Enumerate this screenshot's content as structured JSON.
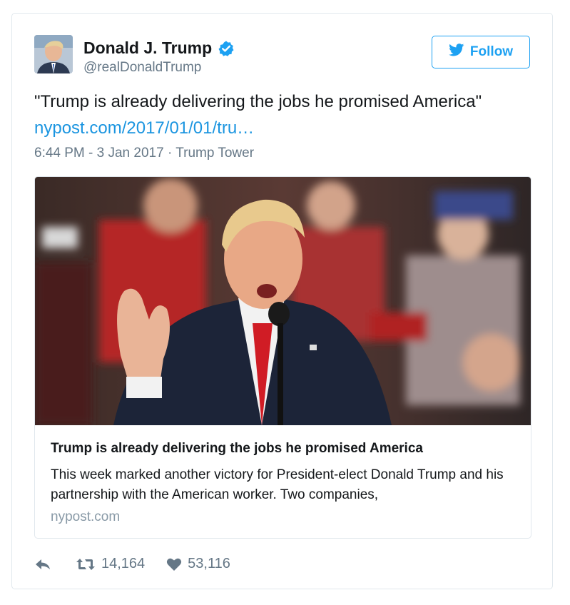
{
  "user": {
    "name": "Donald J. Trump",
    "handle": "@realDonaldTrump",
    "verified": true
  },
  "follow_label": "Follow",
  "tweet": {
    "text": "\"Trump is already delivering the jobs he promised America\"",
    "link": "nypost.com/2017/01/01/tru…",
    "meta": "6:44 PM - 3 Jan 2017 · Trump Tower"
  },
  "link_card": {
    "title": "Trump is already delivering the jobs he promised America",
    "description": "This week marked another victory for President-elect Donald Trump and his partnership with the American worker. Two companies,",
    "domain": "nypost.com"
  },
  "stats": {
    "retweets": "14,164",
    "likes": "53,116"
  },
  "colors": {
    "accent": "#1da1f2",
    "link": "#1b95e0",
    "muted": "#657786"
  },
  "icons": {
    "reply": "reply-icon",
    "retweet": "retweet-icon",
    "like": "heart-icon",
    "verified": "verified-badge-icon",
    "bird": "twitter-bird-icon"
  }
}
